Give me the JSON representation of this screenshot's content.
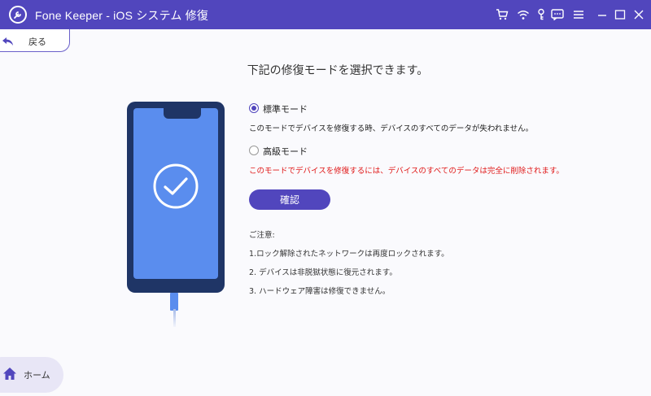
{
  "titlebar": {
    "title": "Fone Keeper - iOS システム 修復",
    "icons": [
      "logo-icon",
      "cart-icon",
      "wifi-icon",
      "key-icon",
      "chat-icon",
      "menu-icon",
      "minimize-icon",
      "maximize-icon",
      "close-icon"
    ]
  },
  "nav": {
    "back_label": "戻る",
    "home_label": "ホーム"
  },
  "main": {
    "heading": "下記の修復モードを選択できます。",
    "options": [
      {
        "label": "標準モード",
        "selected": true,
        "description": "このモードでデバイスを修復する時、デバイスのすべてのデータが失われません。"
      },
      {
        "label": "高級モード",
        "selected": false,
        "description": "このモードでデバイスを修復するには、デバイスのすべてのデータは完全に削除されます。"
      }
    ],
    "confirm_label": "確認",
    "notes_title": "ご注意:",
    "notes": [
      "1.ロック解除されたネットワークは再度ロックされます。",
      "2. デバイスは非脱獄状態に復元されます。",
      "3. ハードウェア障害は修復できません。"
    ]
  },
  "colors": {
    "brand": "#5146bd",
    "warning": "#e01818",
    "phone_body": "#1f3566",
    "phone_screen": "#5a8dee"
  }
}
